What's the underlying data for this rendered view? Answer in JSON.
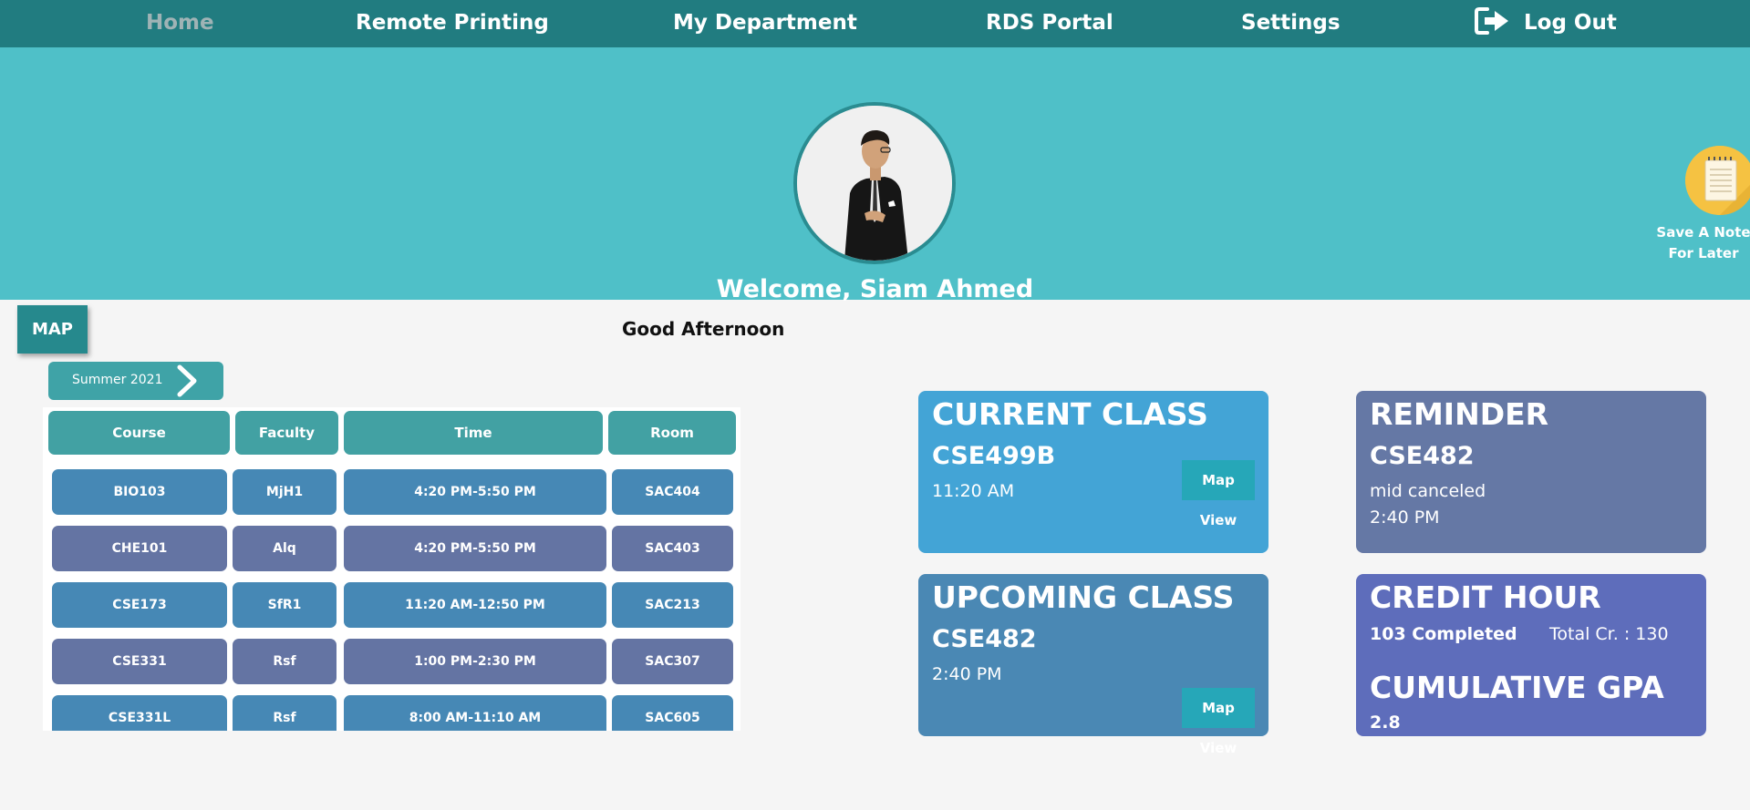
{
  "nav": {
    "home": "Home",
    "remote_printing": "Remote Printing",
    "my_department": "My Department",
    "rds_portal": "RDS Portal",
    "settings": "Settings",
    "log_out": "Log Out"
  },
  "banner": {
    "welcome": "Welcome, Siam Ahmed",
    "note_line1": "Save A Note",
    "note_line2": "For Later"
  },
  "main": {
    "map_button": "MAP",
    "greeting": "Good Afternoon",
    "semester": "Summer 2021"
  },
  "schedule": {
    "headers": [
      "Course",
      "Faculty",
      "Time",
      "Room"
    ],
    "rows": [
      [
        "BIO103",
        "MjH1",
        "4:20 PM-5:50 PM",
        "SAC404"
      ],
      [
        "CHE101",
        "Alq",
        "4:20 PM-5:50 PM",
        "SAC403"
      ],
      [
        "CSE173",
        "SfR1",
        "11:20 AM-12:50 PM",
        "SAC213"
      ],
      [
        "CSE331",
        "Rsf",
        "1:00 PM-2:30 PM",
        "SAC307"
      ],
      [
        "CSE331L",
        "Rsf",
        "8:00 AM-11:10 AM",
        "SAC605"
      ]
    ]
  },
  "cards": {
    "current": {
      "title": "CURRENT CLASS",
      "course": "CSE499B",
      "time": "11:20 AM",
      "button": "Map View"
    },
    "upcoming": {
      "title": "UPCOMING CLASS",
      "course": "CSE482",
      "time": "2:40 PM",
      "button": "Map View"
    },
    "reminder": {
      "title": "REMINDER",
      "course": "CSE482",
      "note": "mid canceled",
      "time": "2:40 PM"
    },
    "credit": {
      "title": "CREDIT HOUR",
      "completed": "103 Completed",
      "total": "Total Cr. : 130",
      "gpa_title": "CUMULATIVE GPA",
      "gpa": "2.8"
    }
  },
  "colors": {
    "nav": "#217c80",
    "banner": "#4fc0c8",
    "current_card": "#43a4d6",
    "upcoming_card": "#4a88b4",
    "reminder_card": "#6578a5",
    "credit_card": "#5e6dbb"
  }
}
